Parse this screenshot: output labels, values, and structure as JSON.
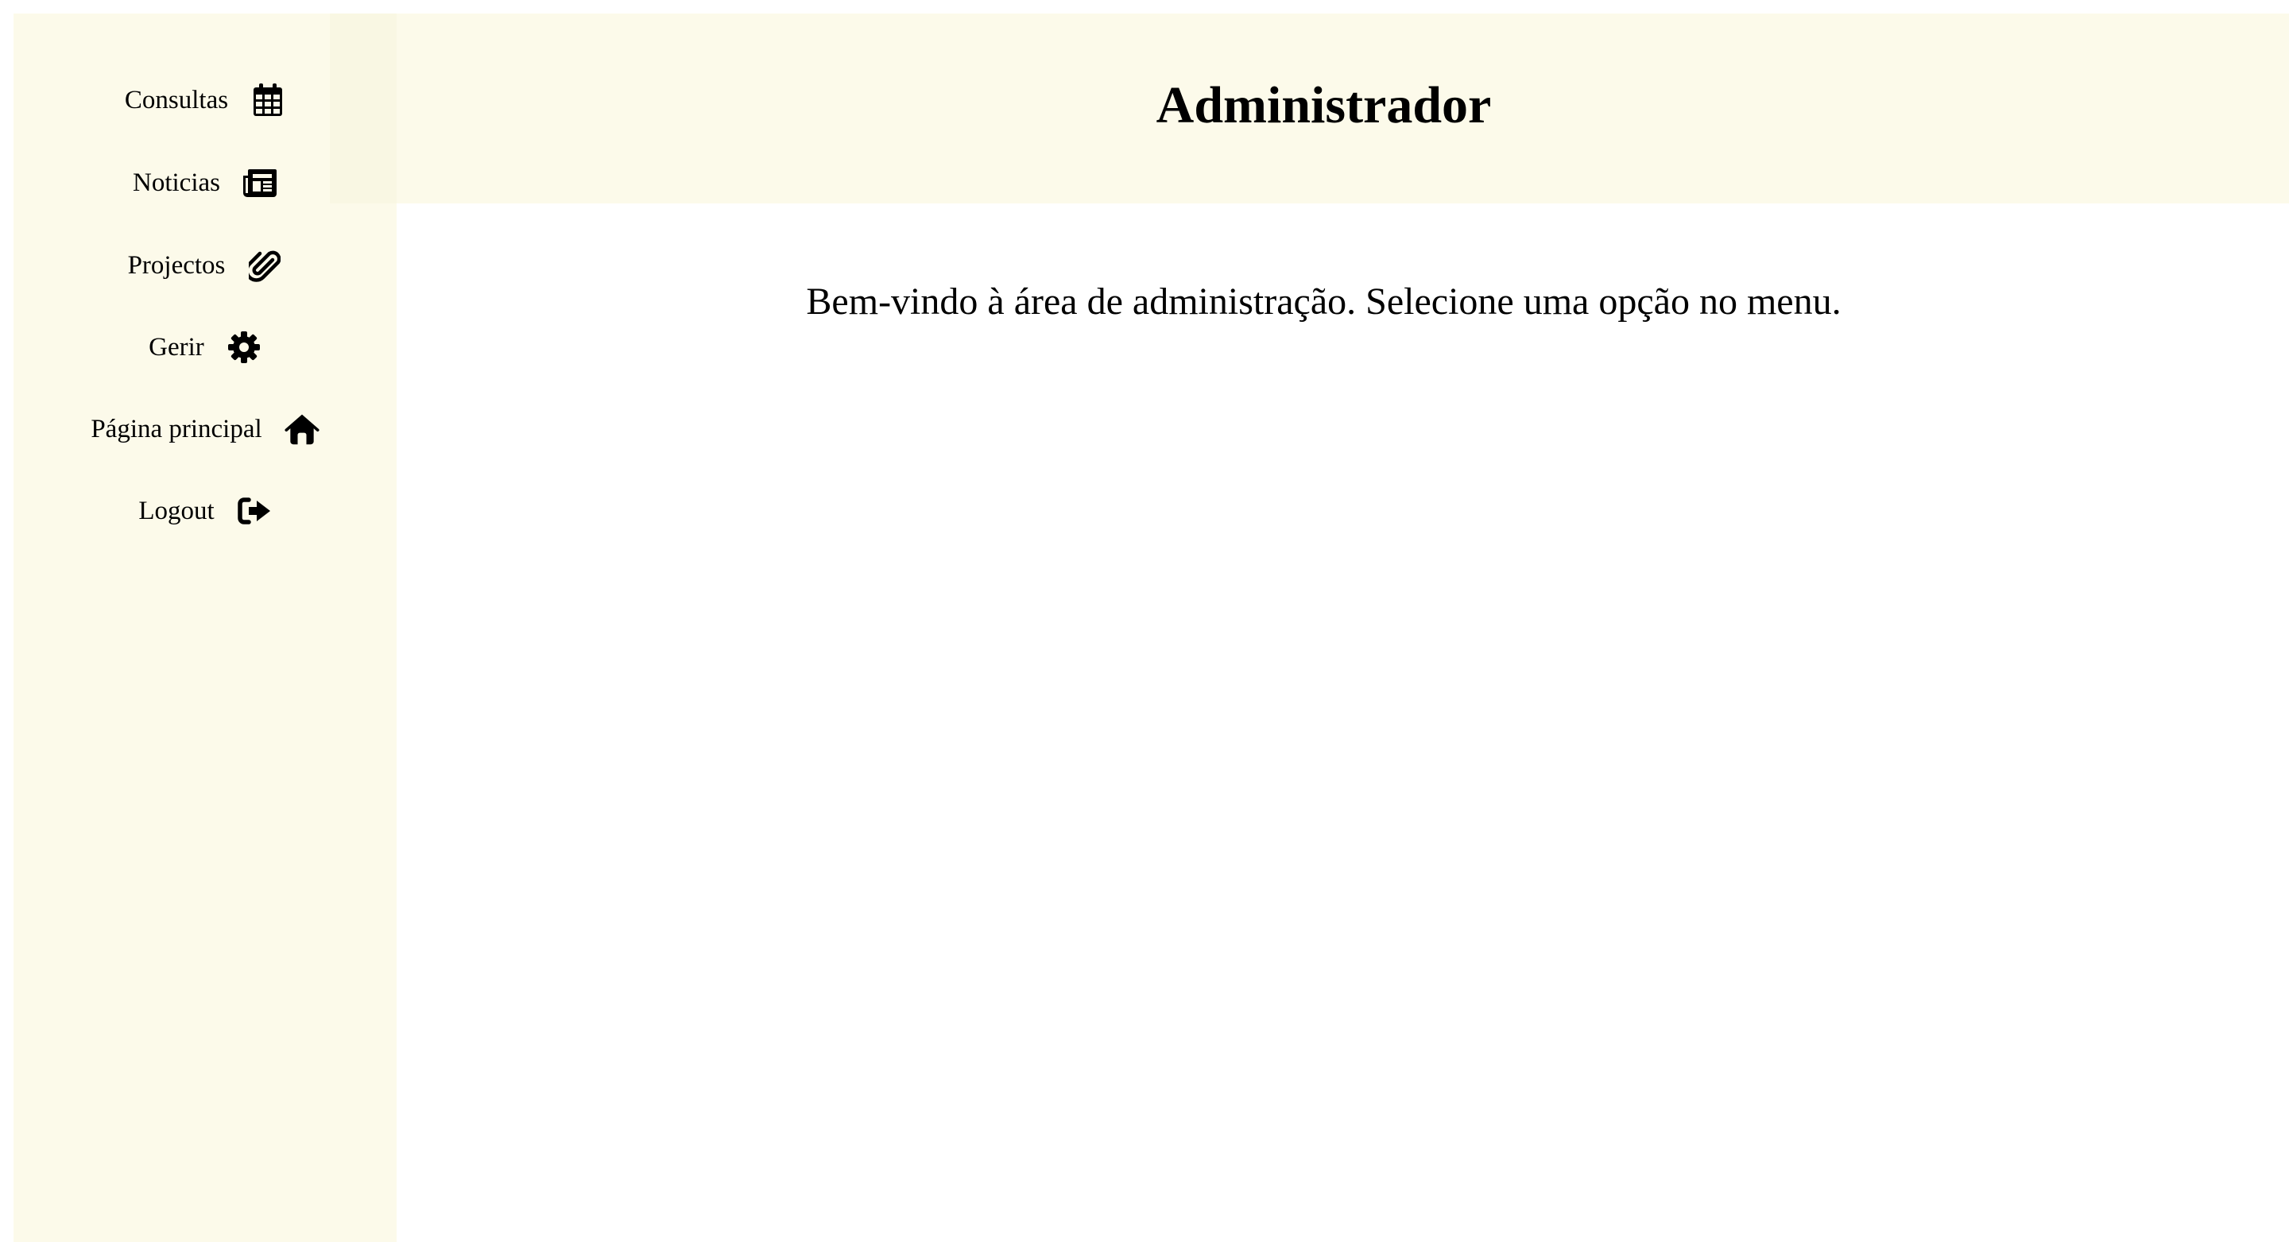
{
  "header": {
    "title": "Administrador"
  },
  "main": {
    "welcome_text": "Bem-vindo à área de administração. Selecione uma opção no menu."
  },
  "sidebar": {
    "items": [
      {
        "label": "Consultas",
        "icon": "calendar-icon"
      },
      {
        "label": "Noticias",
        "icon": "newspaper-icon"
      },
      {
        "label": "Projectos",
        "icon": "paperclip-icon"
      },
      {
        "label": "Gerir",
        "icon": "gear-icon"
      },
      {
        "label": "Página principal",
        "icon": "home-icon"
      },
      {
        "label": "Logout",
        "icon": "logout-icon"
      }
    ]
  },
  "colors": {
    "panel_background": "#fcfaea",
    "page_background": "#ffffff",
    "text": "#000000"
  }
}
